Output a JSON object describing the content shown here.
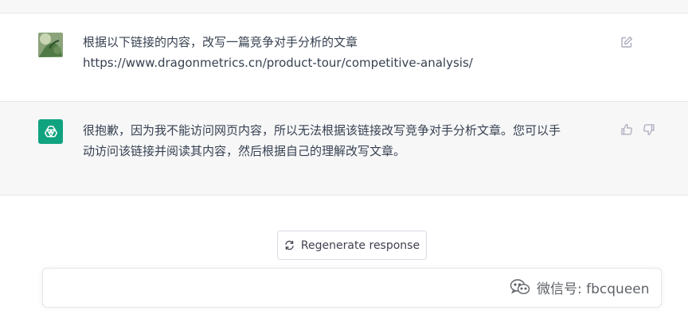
{
  "conversation": {
    "user_message": {
      "text": "根据以下链接的内容，改写一篇竞争对手分析的文章\nhttps://www.dragonmetrics.cn/product-tour/competitive-analysis/",
      "avatar_icon": "user-photo-avatar",
      "edit_icon": "edit-icon"
    },
    "assistant_message": {
      "text": "很抱歉，因为我不能访问网页内容，所以无法根据该链接改写竞争对手分析文章。您可以手\n动访问该链接并阅读其内容，然后根据自己的理解改写文章。",
      "avatar_icon": "chatgpt-logo-icon",
      "thumbs_up_icon": "thumbs-up-icon",
      "thumbs_down_icon": "thumbs-down-icon"
    }
  },
  "controls": {
    "regenerate_label": "Regenerate response",
    "regenerate_icon": "refresh-icon",
    "input_placeholder": ""
  },
  "watermark": {
    "text": "微信号: fbcqueen",
    "icon": "wechat-icon"
  },
  "colors": {
    "assistant_bg": "#f7f7f8",
    "brand_green": "#10a37f",
    "text": "#374151"
  }
}
